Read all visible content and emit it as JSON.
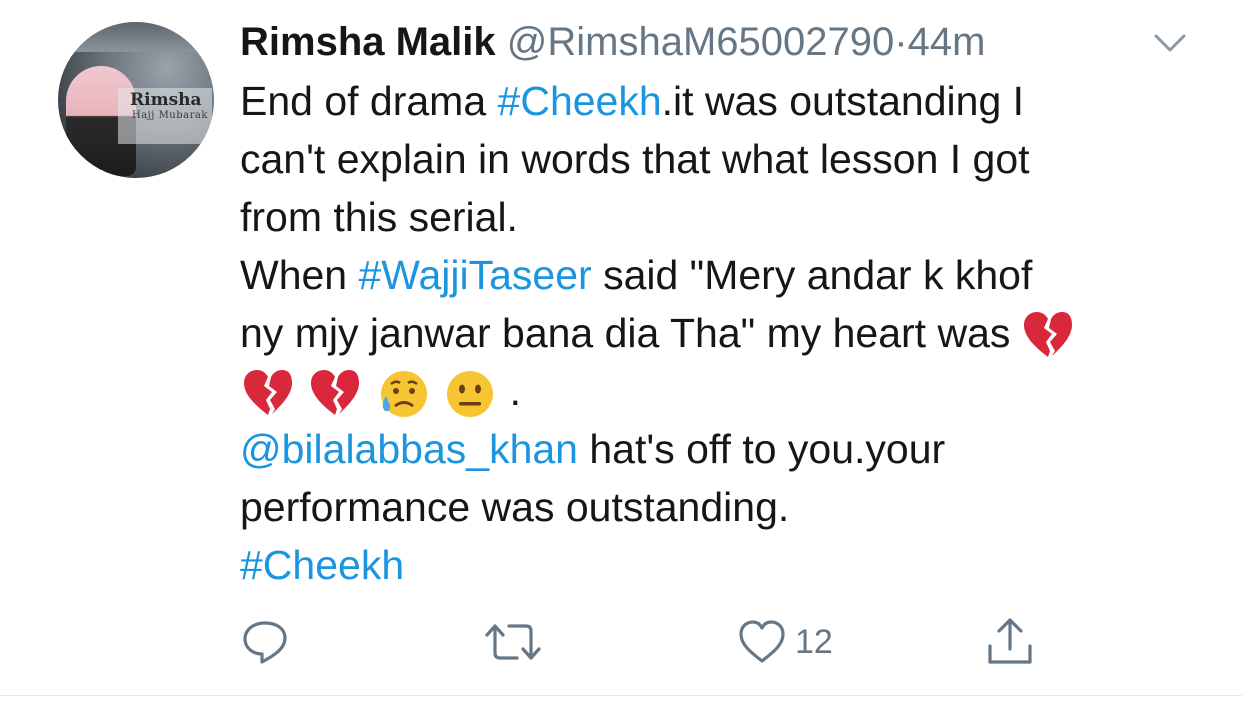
{
  "tweet": {
    "display_name": "Rimsha Malik",
    "handle": "@RimshaM65002790",
    "separator": "·",
    "time": "44m",
    "avatar_text": "Rimsha",
    "avatar_subtext": "Hajj Mubarak",
    "text": {
      "l1_a": "End of drama ",
      "l1_tag": "#Cheekh",
      "l1_b": ".it was outstanding I",
      "l2": "can't explain in words that what lesson I got",
      "l3": "from this serial.",
      "l4_a": "When ",
      "l4_tag": "#WajjiTaseer",
      "l4_b": " said \"Mery andar k khof",
      "l5": "ny mjy janwar bana dia Tha\" my heart was",
      "l6_end": ".",
      "l7_mention": "@bilalabbas_khan",
      "l7_b": " hat's off to you.your",
      "l8": "performance was outstanding.",
      "l9_tag": "#Cheekh"
    },
    "likes_count": "12"
  },
  "colors": {
    "link": "#1b95e0",
    "meta": "#657786",
    "text": "#14171a",
    "broken_heart": "#d9283c"
  },
  "icons": {
    "menu": "chevron-down-icon",
    "reply": "reply-icon",
    "retweet": "retweet-icon",
    "like": "heart-icon",
    "share": "share-icon",
    "emoji_broken_heart": "broken-heart-emoji",
    "emoji_sad": "sad-relieved-emoji",
    "emoji_neutral": "neutral-face-emoji"
  }
}
